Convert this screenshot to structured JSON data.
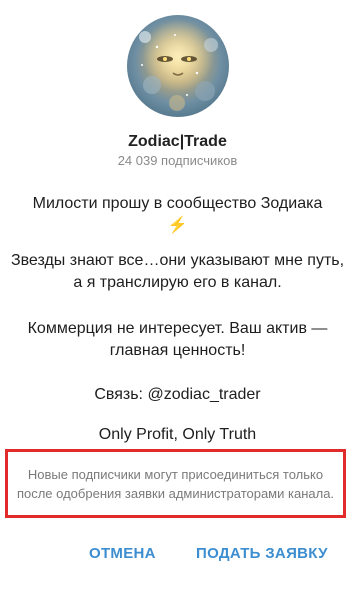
{
  "channel": {
    "name": "Zodiac|Trade",
    "subscribers": "24 039 подписчиков"
  },
  "description": {
    "line1": "Милости прошу в сообщество Зодиака",
    "line1_emoji": "⚡",
    "paragraph2": "Звезды знают все…они указывают мне путь, а я транслирую его в канал.",
    "paragraph3": "Коммерция не интересует. Ваш актив — главная ценность!",
    "contact": "Связь: @zodiac_trader",
    "motto": "Only Profit, Only Truth"
  },
  "notice": {
    "text": "Новые подписчики могут присоединиться только после одобрения заявки администраторами канала."
  },
  "buttons": {
    "cancel": "ОТМЕНА",
    "apply": "ПОДАТЬ ЗАЯВКУ"
  },
  "colors": {
    "accent": "#3c8ed0",
    "highlight_border": "#e12a2a",
    "emoji": "#f2b91e"
  }
}
